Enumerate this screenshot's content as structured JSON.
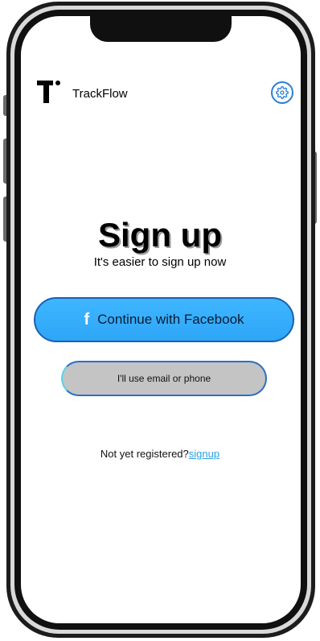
{
  "header": {
    "brand_name": "TrackFlow",
    "settings_icon": "gear-icon"
  },
  "main": {
    "title": "Sign up",
    "subtitle": "It's easier to sign up now",
    "facebook_button": {
      "icon": "facebook-f",
      "icon_glyph": "f",
      "label": "Continue with Facebook"
    },
    "email_button": {
      "label": "I'll use email or phone"
    },
    "register_prompt": "Not yet registered?",
    "register_link": "signup "
  },
  "colors": {
    "facebook_button": "#3fb6ff",
    "email_button": "#c4c4c4",
    "link": "#2aa0e6",
    "accent_border": "#1a5fb4"
  }
}
